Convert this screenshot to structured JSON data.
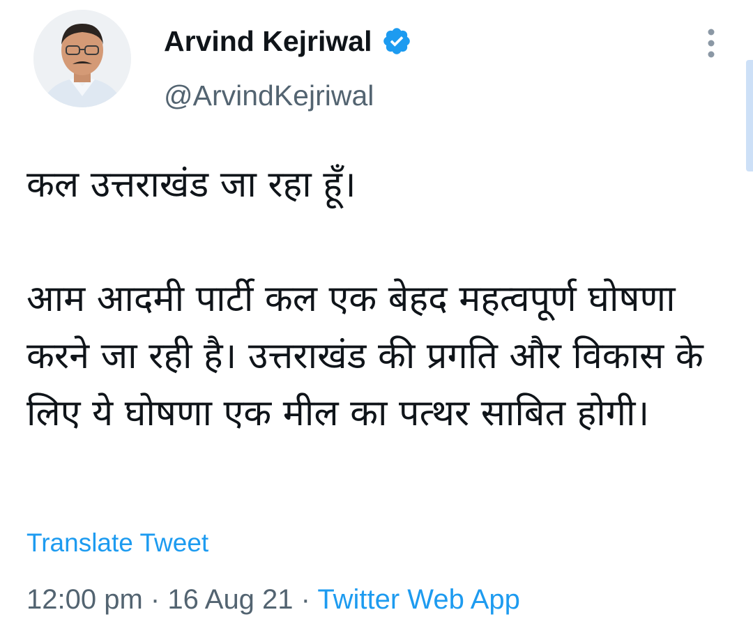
{
  "author": {
    "display_name": "Arvind Kejriwal",
    "handle": "@ArvindKejriwal",
    "verified": true,
    "verified_icon": "verified-badge-icon",
    "avatar": "profile-photo"
  },
  "menu": {
    "icon": "more-vertical-icon"
  },
  "tweet": {
    "text_line1": "कल उत्तराखंड जा रहा हूँ।",
    "text_paragraph2": "आम आदमी पार्टी कल एक बेहद महत्वपूर्ण घोषणा करने जा रही है। उत्तराखंड की प्रगति और विकास के लिए ये घोषणा एक मील का पत्थर साबित होगी।",
    "translate_label": "Translate Tweet",
    "time": "12:00 pm",
    "separator": "·",
    "date": "16 Aug 21",
    "source": "Twitter Web App"
  },
  "colors": {
    "link": "#1d9bf0",
    "secondary_text": "#536471",
    "primary_text": "#0f1419",
    "scrollbar": "#cde0f7"
  }
}
